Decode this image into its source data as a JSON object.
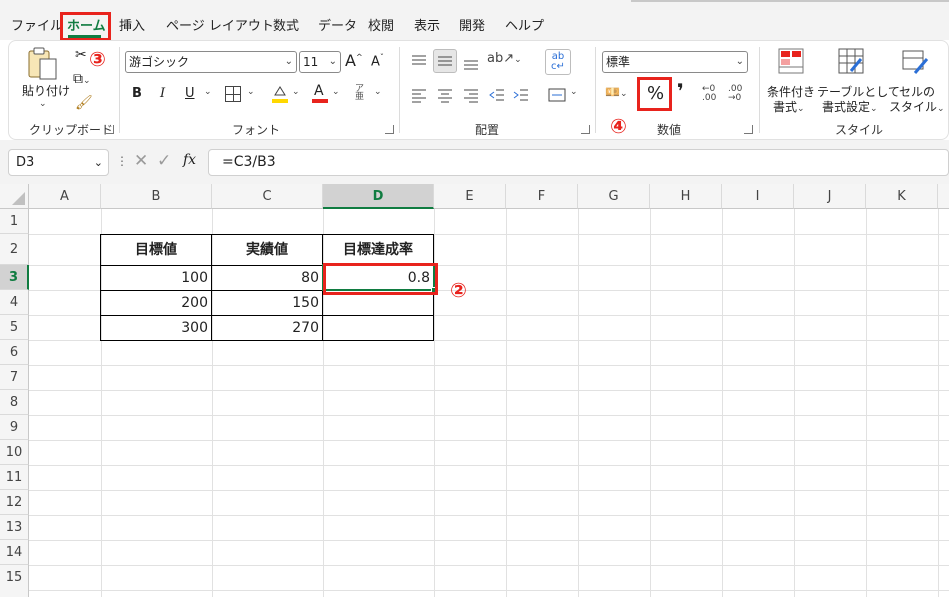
{
  "menu": {
    "items": [
      "ファイル",
      "ホーム",
      "挿入",
      "ページ レイアウト",
      "数式",
      "データ",
      "校閲",
      "表示",
      "開発",
      "ヘルプ"
    ]
  },
  "ribbon": {
    "clipboard": {
      "paste_label_1": "貼り付け",
      "paste_label_2": "",
      "group_label": "クリップボード"
    },
    "font": {
      "font_name": "游ゴシック",
      "font_size": "11",
      "group_label": "フォント",
      "grow": "A",
      "shrink": "A",
      "bold": "B",
      "italic": "I",
      "underline": "U",
      "font_color": "A"
    },
    "alignment": {
      "group_label": "配置"
    },
    "number": {
      "format": "標準",
      "percent": "%",
      "comma": "❜",
      "group_label": "数値"
    },
    "styles": {
      "conditional_1": "条件付き",
      "conditional_2": "書式",
      "table_1": "テーブルとして",
      "table_2": "書式設定",
      "cell_1": "セルの",
      "cell_2": "スタイル",
      "group_label": "スタイル"
    }
  },
  "annotations": {
    "n2": "②",
    "n3": "③",
    "n4": "④"
  },
  "formula_bar": {
    "name_box": "D3",
    "formula": "=C3/B3",
    "fx": "fx"
  },
  "columns": [
    "A",
    "B",
    "C",
    "D",
    "E",
    "F",
    "G",
    "H",
    "I",
    "J",
    "K"
  ],
  "rows": [
    "1",
    "2",
    "3",
    "4",
    "5",
    "6",
    "7",
    "8",
    "9",
    "10",
    "11",
    "12",
    "13",
    "14",
    "15"
  ],
  "table": {
    "headers": [
      "目標値",
      "実績値",
      "目標達成率"
    ],
    "rows": [
      [
        "100",
        "80",
        "0.8"
      ],
      [
        "200",
        "150",
        ""
      ],
      [
        "300",
        "270",
        ""
      ]
    ]
  },
  "colors": {
    "accent": "#107c41",
    "annotation": "#e8231d"
  }
}
